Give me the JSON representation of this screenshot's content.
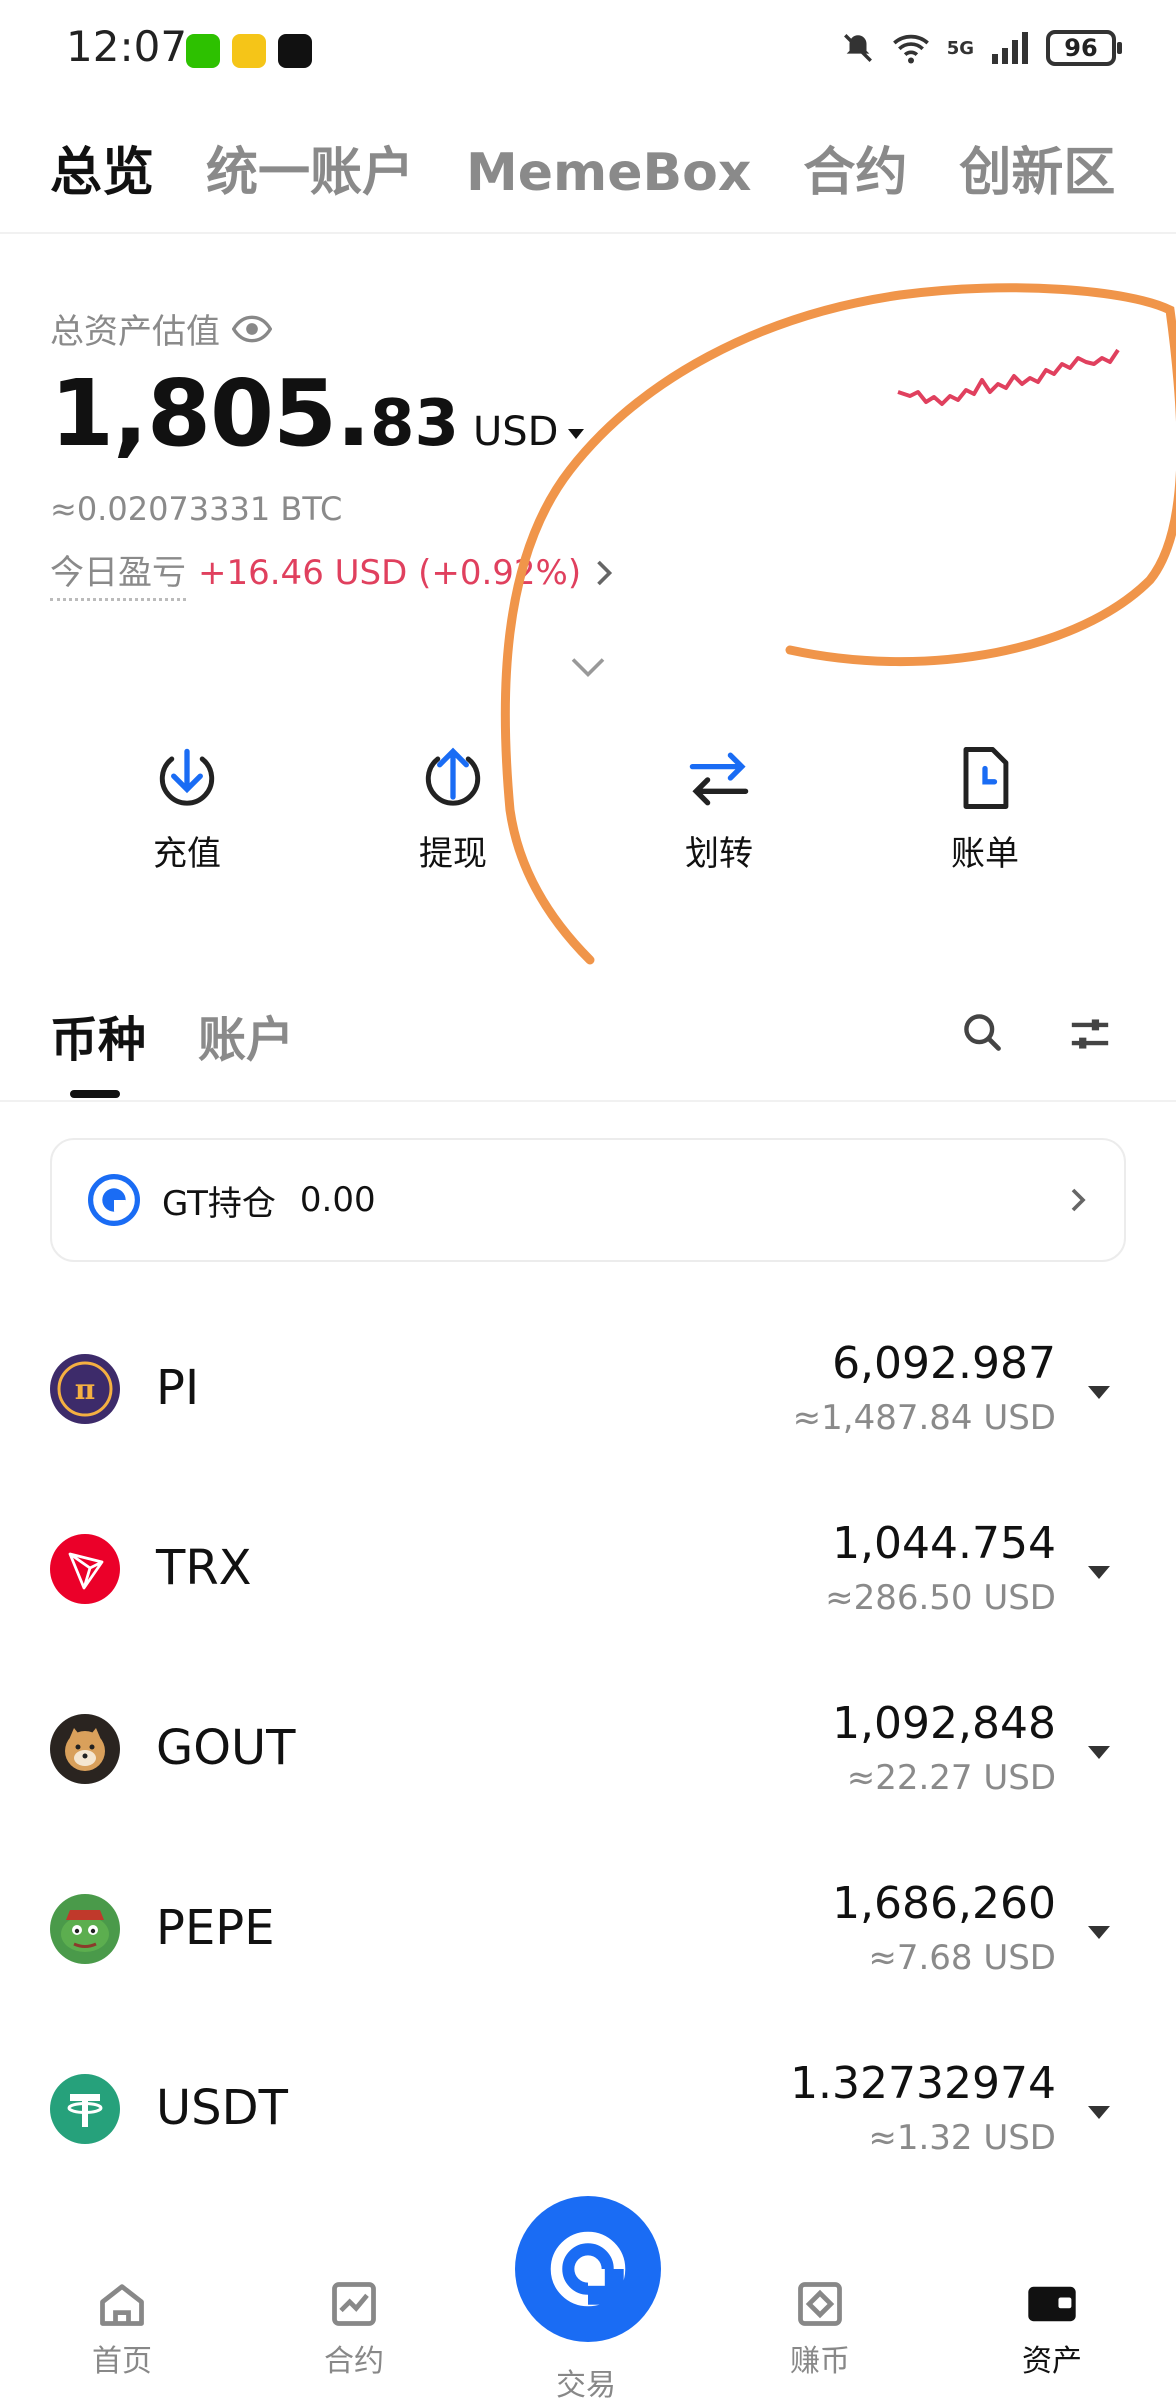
{
  "status": {
    "time": "12:07",
    "net": "5G",
    "battery": "96"
  },
  "top_tabs": [
    "总览",
    "统一账户",
    "MemeBox",
    "合约",
    "创新区"
  ],
  "asset": {
    "label": "总资产估值",
    "total_int": "1,805.",
    "total_dec": "83",
    "currency": "USD",
    "btc": "≈0.02073331 BTC",
    "pnl_label": "今日盈亏",
    "pnl_value": "+16.46 USD (+0.92%)"
  },
  "actions": [
    {
      "label": "充值",
      "icon": "deposit-icon"
    },
    {
      "label": "提现",
      "icon": "withdraw-icon"
    },
    {
      "label": "划转",
      "icon": "transfer-icon"
    },
    {
      "label": "账单",
      "icon": "bill-icon"
    }
  ],
  "coin_tabs": [
    "币种",
    "账户"
  ],
  "gt_card": {
    "label": "GT持仓",
    "value": "0.00"
  },
  "coins": [
    {
      "name": "PI",
      "amount": "6,092.987",
      "usd": "≈1,487.84 USD",
      "color": "#3d2b6a"
    },
    {
      "name": "TRX",
      "amount": "1,044.754",
      "usd": "≈286.50 USD",
      "color": "#eb0029"
    },
    {
      "name": "GOUT",
      "amount": "1,092,848",
      "usd": "≈22.27 USD",
      "color": "#c58a4a"
    },
    {
      "name": "PEPE",
      "amount": "1,686,260",
      "usd": "≈7.68 USD",
      "color": "#4a9a4a"
    },
    {
      "name": "USDT",
      "amount": "1.32732974",
      "usd": "≈1.32 USD",
      "color": "#26a17b"
    }
  ],
  "bottom_nav": [
    "首页",
    "合约",
    "交易",
    "赚币",
    "资产"
  ],
  "colors": {
    "accent": "#1a6cf4",
    "profit": "#e0405e",
    "annotation": "#f0954a"
  }
}
